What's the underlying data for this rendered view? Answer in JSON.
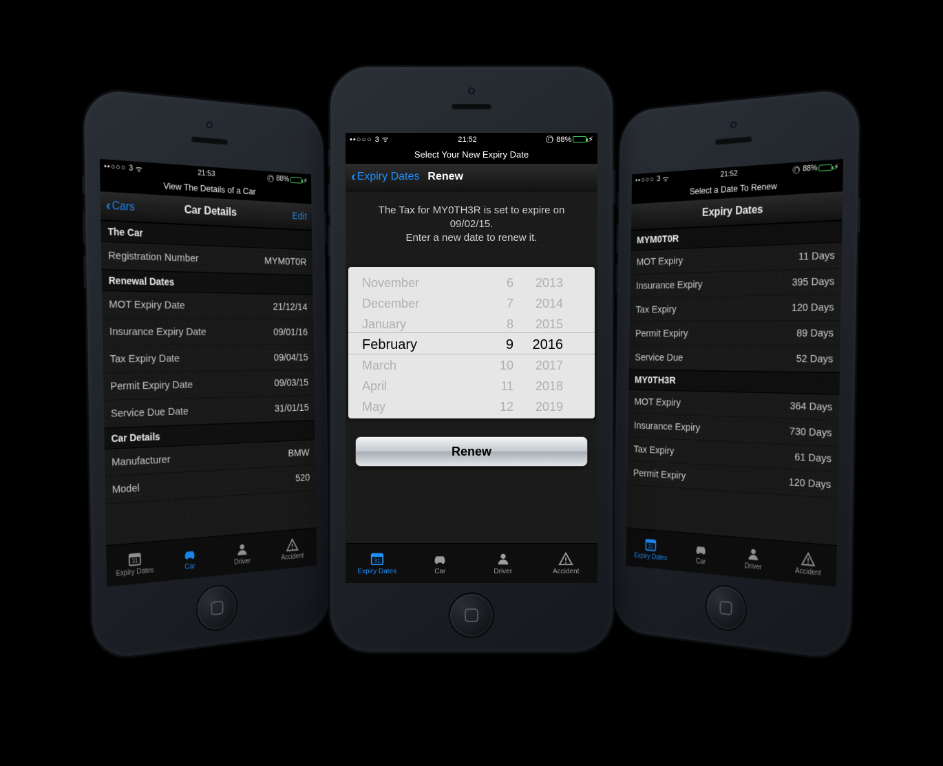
{
  "colors": {
    "accent": "#1e90ff",
    "battery": "#4cd964"
  },
  "tabs": {
    "expiry": "Expiry Dates",
    "car": "Car",
    "driver": "Driver",
    "accident": "Accident"
  },
  "status": {
    "carrier": "3",
    "battery_pct": "88%"
  },
  "left": {
    "time": "21:53",
    "subtitle": "View The Details of a Car",
    "back": "Cars",
    "title": "Car Details",
    "edit": "Edit",
    "section_car": "The Car",
    "reg_label": "Registration Number",
    "reg_value": "MYM0T0R",
    "section_renewal": "Renewal Dates",
    "mot_label": "MOT Expiry Date",
    "mot_value": "21/12/14",
    "ins_label": "Insurance Expiry Date",
    "ins_value": "09/01/16",
    "tax_label": "Tax Expiry Date",
    "tax_value": "09/04/15",
    "permit_label": "Permit Expiry Date",
    "permit_value": "09/03/15",
    "service_label": "Service Due Date",
    "service_value": "31/01/15",
    "section_details": "Car Details",
    "mfg_label": "Manufacturer",
    "mfg_value": "BMW",
    "model_label": "Model",
    "model_value": "520"
  },
  "center": {
    "time": "21:52",
    "subtitle": "Select Your New Expiry Date",
    "back": "Expiry Dates",
    "title": "Renew",
    "info1": "The Tax for MY0TH3R is set to expire on 09/02/15.",
    "info2": "Enter a new date to renew it.",
    "picker": {
      "months": [
        "November",
        "December",
        "January",
        "February",
        "March",
        "April",
        "May"
      ],
      "days": [
        "6",
        "7",
        "8",
        "9",
        "10",
        "11",
        "12"
      ],
      "years": [
        "2013",
        "2014",
        "2015",
        "2016",
        "2017",
        "2018",
        "2019"
      ],
      "sel_index": 3
    },
    "renew_btn": "Renew"
  },
  "right": {
    "time": "21:52",
    "subtitle": "Select a Date To Renew",
    "title": "Expiry Dates",
    "groups": [
      {
        "name": "MYM0T0R",
        "rows": [
          {
            "label": "MOT Expiry",
            "days": "11 Days"
          },
          {
            "label": "Insurance Expiry",
            "days": "395 Days"
          },
          {
            "label": "Tax Expiry",
            "days": "120 Days"
          },
          {
            "label": "Permit Expiry",
            "days": "89 Days"
          },
          {
            "label": "Service Due",
            "days": "52 Days"
          }
        ]
      },
      {
        "name": "MY0TH3R",
        "rows": [
          {
            "label": "MOT Expiry",
            "days": "364 Days"
          },
          {
            "label": "Insurance Expiry",
            "days": "730 Days"
          },
          {
            "label": "Tax Expiry",
            "days": "61 Days"
          },
          {
            "label": "Permit Expiry",
            "days": "120 Days"
          }
        ]
      }
    ]
  }
}
